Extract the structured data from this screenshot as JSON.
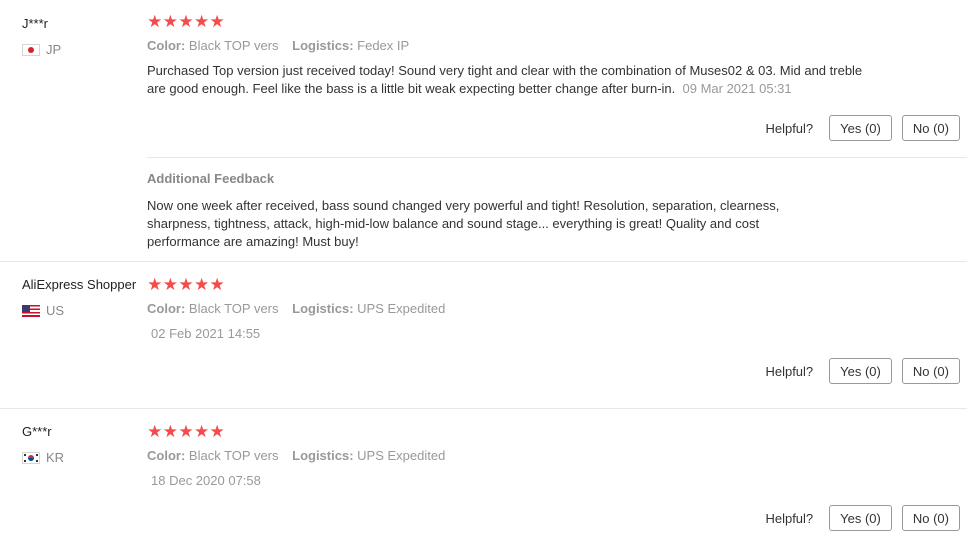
{
  "labels": {
    "color": "Color:",
    "logistics": "Logistics:",
    "helpful": "Helpful?",
    "yes": "Yes (0)",
    "no": "No (0)",
    "additional_feedback": "Additional Feedback"
  },
  "colors": {
    "star": "#f44c4c",
    "divider": "#e8e8e8",
    "muted": "#999999"
  },
  "reviews": [
    {
      "user": "J***r",
      "country": "JP",
      "flag": "jp-flag",
      "rating": 5,
      "color_value": "Black TOP vers",
      "logistics_value": "Fedex IP",
      "text": "Purchased Top version just received today! Sound very tight and clear with the combination of Muses02 & 03. Mid and treble are good enough. Feel like the bass is a little bit weak expecting better change after burn-in.",
      "date": "09 Mar 2021 05:31",
      "additional_feedback": "Now one week after received, bass sound changed very powerful and tight! Resolution, separation, clearness, sharpness, tightness, attack, high-mid-low balance and sound stage... everything is great! Quality and cost performance are amazing! Must buy!"
    },
    {
      "user": "AliExpress Shopper",
      "country": "US",
      "flag": "us-flag",
      "rating": 5,
      "color_value": "Black TOP vers",
      "logistics_value": "UPS Expedited",
      "date": "02 Feb 2021 14:55"
    },
    {
      "user": "G***r",
      "country": "KR",
      "flag": "kr-flag",
      "rating": 5,
      "color_value": "Black TOP vers",
      "logistics_value": "UPS Expedited",
      "date": "18 Dec 2020 07:58"
    }
  ]
}
